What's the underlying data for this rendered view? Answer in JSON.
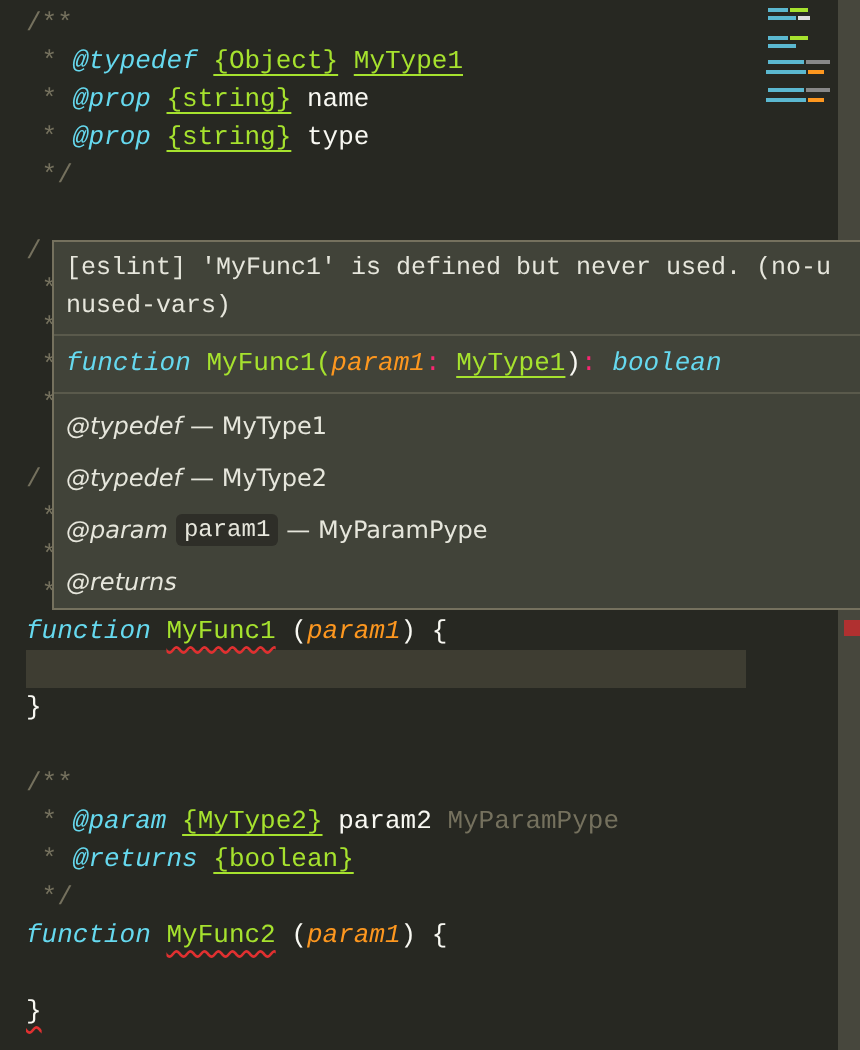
{
  "editor": {
    "lines": [
      {
        "kind": "code",
        "tokens": [
          {
            "text": "/**",
            "kind": "comment",
            "error": false
          }
        ]
      },
      {
        "kind": "code",
        "tokens": [
          {
            "text": " *",
            "kind": "comment",
            "error": false
          },
          {
            "text": "@typedef",
            "kind": "tag",
            "error": false
          },
          {
            "text": "{Object}",
            "kind": "type",
            "error": false
          },
          {
            "text": "MyType1",
            "kind": "type",
            "error": false
          }
        ]
      },
      {
        "kind": "code",
        "tokens": [
          {
            "text": " *",
            "kind": "comment",
            "error": false
          },
          {
            "text": "@prop",
            "kind": "tag",
            "error": false
          },
          {
            "text": "{string}",
            "kind": "type",
            "error": false
          },
          {
            "text": "name",
            "kind": "plain",
            "error": false
          }
        ]
      },
      {
        "kind": "code",
        "tokens": [
          {
            "text": " *",
            "kind": "comment",
            "error": false
          },
          {
            "text": "@prop",
            "kind": "tag",
            "error": false
          },
          {
            "text": "{string}",
            "kind": "type",
            "error": false
          },
          {
            "text": "type",
            "kind": "plain",
            "error": false
          }
        ]
      },
      {
        "kind": "code",
        "tokens": [
          {
            "text": " */",
            "kind": "comment",
            "error": false
          }
        ]
      },
      {
        "kind": "blank"
      },
      {
        "kind": "code",
        "tokens": [
          {
            "text": "/",
            "kind": "comment",
            "error": false
          }
        ]
      },
      {
        "kind": "code",
        "tokens": [
          {
            "text": " *",
            "kind": "comment",
            "error": false
          }
        ]
      },
      {
        "kind": "code",
        "tokens": [
          {
            "text": " *",
            "kind": "comment",
            "error": false
          }
        ]
      },
      {
        "kind": "code",
        "tokens": [
          {
            "text": " *",
            "kind": "comment",
            "error": false
          }
        ]
      },
      {
        "kind": "code",
        "tokens": [
          {
            "text": " *",
            "kind": "comment",
            "error": false
          }
        ]
      },
      {
        "kind": "blank"
      },
      {
        "kind": "code",
        "tokens": [
          {
            "text": "/",
            "kind": "comment",
            "error": false
          }
        ]
      },
      {
        "kind": "code",
        "tokens": [
          {
            "text": " *",
            "kind": "comment",
            "error": false
          }
        ]
      },
      {
        "kind": "code",
        "tokens": [
          {
            "text": " *",
            "kind": "comment",
            "error": false
          }
        ]
      },
      {
        "kind": "code",
        "tokens": [
          {
            "text": " *",
            "kind": "comment",
            "error": false
          }
        ]
      },
      {
        "kind": "code",
        "tokens": [
          {
            "text": "function",
            "kind": "keyword",
            "error": false
          },
          {
            "text": "MyFunc1",
            "kind": "fn",
            "error": true
          },
          {
            "text": "(",
            "kind": "plain",
            "error": false
          },
          {
            "text": "param1",
            "kind": "param",
            "error": false
          },
          {
            "text": ") {",
            "kind": "plain",
            "error": false
          }
        ]
      },
      {
        "kind": "cursor"
      },
      {
        "kind": "code",
        "tokens": [
          {
            "text": "}",
            "kind": "plain",
            "error": false
          }
        ]
      },
      {
        "kind": "blank"
      },
      {
        "kind": "code",
        "tokens": [
          {
            "text": "/**",
            "kind": "comment",
            "error": false
          }
        ]
      },
      {
        "kind": "code",
        "tokens": [
          {
            "text": " *",
            "kind": "comment",
            "error": false
          },
          {
            "text": "@param",
            "kind": "tag",
            "error": false
          },
          {
            "text": "{MyType2}",
            "kind": "type",
            "error": false
          },
          {
            "text": "param2",
            "kind": "plain",
            "error": false
          },
          {
            "text": "MyParamPype",
            "kind": "comment",
            "error": false
          }
        ]
      },
      {
        "kind": "code",
        "tokens": [
          {
            "text": " *",
            "kind": "comment",
            "error": false
          },
          {
            "text": "@returns",
            "kind": "tag",
            "error": false
          },
          {
            "text": "{boolean}",
            "kind": "type",
            "error": false
          }
        ]
      },
      {
        "kind": "code",
        "tokens": [
          {
            "text": " */",
            "kind": "comment",
            "error": false
          }
        ]
      },
      {
        "kind": "code",
        "tokens": [
          {
            "text": "function",
            "kind": "keyword",
            "error": false
          },
          {
            "text": "MyFunc2",
            "kind": "fn",
            "error": true
          },
          {
            "text": "(",
            "kind": "plain",
            "error": false
          },
          {
            "text": "param1",
            "kind": "param",
            "error": false
          },
          {
            "text": ") {",
            "kind": "plain",
            "error": false
          }
        ]
      },
      {
        "kind": "blank"
      },
      {
        "kind": "code",
        "tokens": [
          {
            "text": "}",
            "kind": "plain",
            "error": true
          }
        ]
      }
    ]
  },
  "hover": {
    "message": [
      "[eslint] 'MyFunc1' is defined but never used. (no-u",
      "nused-vars)"
    ],
    "signature": [
      {
        "text": "function",
        "kind": "keyword"
      },
      {
        "text": "MyFunc1(",
        "kind": "fn"
      },
      {
        "text": "param1",
        "kind": "param"
      },
      {
        "text": ":",
        "kind": "punct"
      },
      {
        "text": "MyType1",
        "kind": "type"
      },
      {
        "text": ")",
        "kind": "plain"
      },
      {
        "text": ":",
        "kind": "punct"
      },
      {
        "text": "boolean",
        "kind": "keyword"
      }
    ],
    "docs": [
      {
        "tag": "@typedef",
        "text": "— MyType1"
      },
      {
        "tag": "@typedef",
        "text": "— MyType2"
      },
      {
        "tag": "@param",
        "code": "param1",
        "text": "— MyParamPype"
      },
      {
        "tag": "@returns"
      }
    ]
  }
}
